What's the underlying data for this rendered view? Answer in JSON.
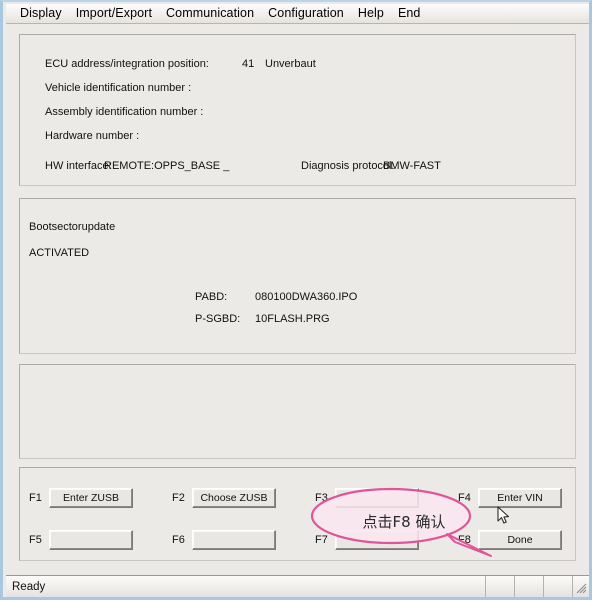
{
  "window": {
    "menu": [
      {
        "label": "Display"
      },
      {
        "label": "Import/Export"
      },
      {
        "label": "Communication"
      },
      {
        "label": "Configuration"
      },
      {
        "label": "Help"
      },
      {
        "label": "End"
      }
    ]
  },
  "ecu_panel": {
    "rows": [
      {
        "label": "ECU address/integration position:",
        "value": "41",
        "value2": "Unverbaut"
      },
      {
        "label": "Vehicle identification number :",
        "value": "",
        "value2": ""
      },
      {
        "label": "Assembly identification number :",
        "value": "",
        "value2": ""
      },
      {
        "label": "Hardware number :",
        "value": "",
        "value2": ""
      }
    ],
    "hw_interface_label": "HW interface:",
    "hw_interface_value": "REMOTE:OPPS_BASE _",
    "protocol_label": "Diagnosis protocol:",
    "protocol_value": "BMW-FAST"
  },
  "boot_panel": {
    "title": "Bootsectorupdate",
    "state": "ACTIVATED",
    "pabd_label": "PABD:",
    "pabd_value": "080100DWA360.IPO",
    "psgbd_label": "P-SGBD:",
    "psgbd_value": "10FLASH.PRG"
  },
  "empty_panel": {
    "content": ""
  },
  "function_keys": [
    {
      "tag": "F1",
      "label": "Enter ZUSB",
      "enabled": true
    },
    {
      "tag": "F2",
      "label": "Choose ZUSB",
      "enabled": true
    },
    {
      "tag": "F3",
      "label": "",
      "enabled": false
    },
    {
      "tag": "F4",
      "label": "Enter VIN",
      "enabled": true
    },
    {
      "tag": "F5",
      "label": "",
      "enabled": false
    },
    {
      "tag": "F6",
      "label": "",
      "enabled": false
    },
    {
      "tag": "F7",
      "label": "",
      "enabled": false
    },
    {
      "tag": "F8",
      "label": "Done",
      "enabled": true
    }
  ],
  "annotation": {
    "text": "点击F8 确认",
    "stroke_color": "#e0559a",
    "fill_color": "#fbe6f0"
  },
  "statusbar": {
    "message": "Ready",
    "segments": [
      "",
      "",
      ""
    ],
    "grip": "resize-grip"
  }
}
